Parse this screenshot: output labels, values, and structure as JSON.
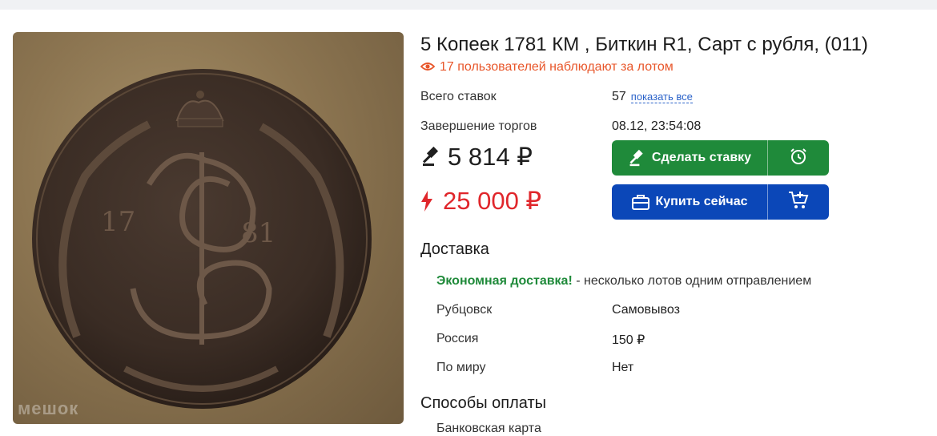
{
  "lot": {
    "title": "5 Копеек 1781 КМ , Биткин R1, Сарт с рубля, (011)",
    "watchers": "17 пользователей наблюдают за лотом",
    "image_watermark": "мешок"
  },
  "bids": {
    "label": "Всего ставок",
    "count": "57",
    "show_all": "показать все"
  },
  "end": {
    "label": "Завершение торгов",
    "value": "08.12, 23:54:08"
  },
  "prices": {
    "current": "5 814 ₽",
    "buy_now": "25 000 ₽"
  },
  "buttons": {
    "bid": "Сделать ставку",
    "buy": "Купить сейчас",
    "alarm_icon": "alarm-clock-icon",
    "cart_icon": "cart-add-icon"
  },
  "delivery": {
    "title": "Доставка",
    "econ_label": "Экономная доставка!",
    "econ_text": " - несколько лотов одним отправлением",
    "rows": [
      {
        "label": "Рубцовск",
        "value": "Самовывоз"
      },
      {
        "label": "Россия",
        "value": "150 ₽"
      },
      {
        "label": "По миру",
        "value": "Нет"
      }
    ]
  },
  "payment": {
    "title": "Способы оплаты",
    "first_method": "Банковская карта"
  },
  "colors": {
    "green": "#1f8a3a",
    "blue": "#0b47b8",
    "red": "#e0262b",
    "orange": "#e8562a"
  }
}
